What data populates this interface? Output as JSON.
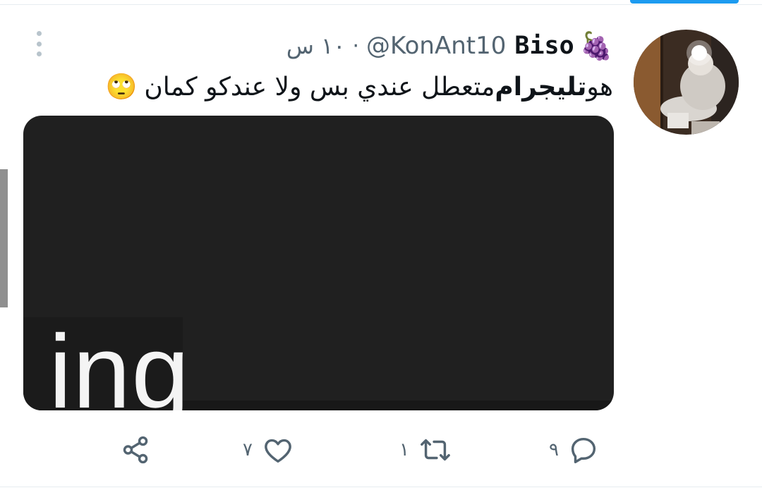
{
  "tweet": {
    "author_emoji": "🍇",
    "author_name": "Biso",
    "handle": "@KonAnt10",
    "separator": "·",
    "time": "١٠ س",
    "text_start": "هو ",
    "text_bold": "تليجرام",
    "text_end": " متعطل عندي بس ولا عندكو كمان",
    "text_emoji": "🙄",
    "media_text": "ing"
  },
  "actions": {
    "reply_count": "٩",
    "retweet_count": "١",
    "like_count": "٧"
  },
  "colors": {
    "accent": "#1d9bf0",
    "secondary_text": "#536471",
    "media_background": "#202020"
  },
  "icons": [
    "more-vertical-icon",
    "reply-icon",
    "retweet-icon",
    "like-icon",
    "share-icon"
  ]
}
